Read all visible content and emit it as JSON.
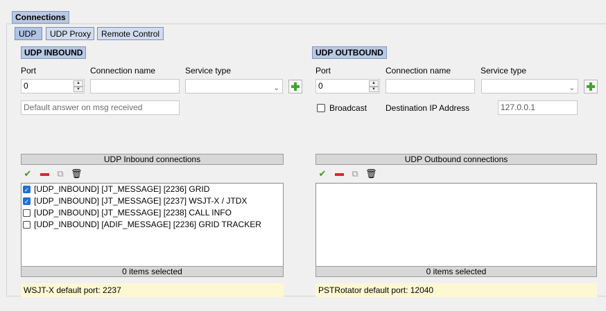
{
  "section_title": "Connections",
  "tabs": [
    {
      "label": "UDP",
      "active": true
    },
    {
      "label": "UDP Proxy",
      "active": false
    },
    {
      "label": "Remote Control",
      "active": false
    }
  ],
  "inbound": {
    "title": "UDP INBOUND",
    "port_label": "Port",
    "port_value": "0",
    "name_label": "Connection name",
    "name_value": "",
    "service_label": "Service type",
    "service_value": "",
    "default_answer_placeholder": "Default answer on msg received",
    "list_header": "UDP Inbound connections",
    "items": [
      {
        "label": "[UDP_INBOUND] [JT_MESSAGE] [2236] GRID",
        "checked": true
      },
      {
        "label": "[UDP_INBOUND] [JT_MESSAGE] [2237] WSJT-X / JTDX",
        "checked": true
      },
      {
        "label": "[UDP_INBOUND] [JT_MESSAGE] [2238] CALL INFO",
        "checked": false
      },
      {
        "label": "[UDP_INBOUND] [ADIF_MESSAGE] [2236] GRID TRACKER",
        "checked": false
      }
    ],
    "footer": "0 items selected",
    "note": "WSJT-X default port: 2237"
  },
  "outbound": {
    "title": "UDP OUTBOUND",
    "port_label": "Port",
    "port_value": "0",
    "name_label": "Connection name",
    "name_value": "",
    "service_label": "Service type",
    "service_value": "",
    "broadcast_label": "Broadcast",
    "broadcast_checked": false,
    "dest_ip_label": "Destination IP Address",
    "dest_ip_value": "127.0.0.1",
    "list_header": "UDP Outbound connections",
    "items": [],
    "footer": "0 items selected",
    "note": "PSTRotator default port: 12040"
  },
  "toolbar_icons": [
    "check-all-icon",
    "remove-icon",
    "duplicate-icon",
    "delete-icon"
  ]
}
